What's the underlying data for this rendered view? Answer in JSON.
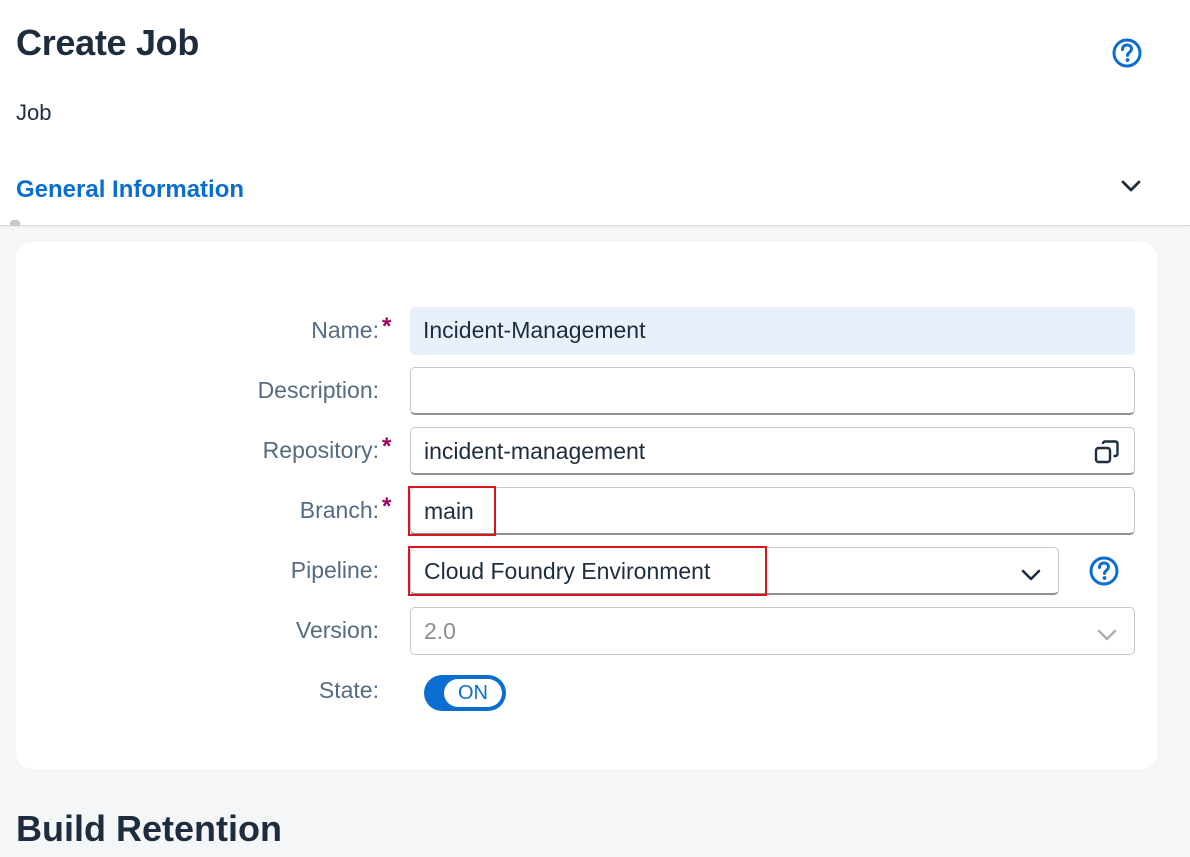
{
  "header": {
    "title": "Create Job",
    "subtitle": "Job",
    "section_tab": "General Information"
  },
  "form": {
    "name": {
      "label": "Name:",
      "value": "Incident-Management",
      "required": true
    },
    "description": {
      "label": "Description:",
      "value": "",
      "required": false
    },
    "repository": {
      "label": "Repository:",
      "value": "incident-management",
      "required": true
    },
    "branch": {
      "label": "Branch:",
      "value": "main",
      "required": true
    },
    "pipeline": {
      "label": "Pipeline:",
      "value": "Cloud Foundry Environment",
      "required": false
    },
    "version": {
      "label": "Version:",
      "value": "2.0",
      "required": false
    },
    "state": {
      "label": "State:",
      "value": "ON"
    },
    "required_marker": "*"
  },
  "build_retention": {
    "title": "Build Retention"
  },
  "colors": {
    "accent": "#0a6ed1",
    "title": "#1d2d3e",
    "label": "#556b82",
    "required": "#a50060",
    "highlight": "#d9141c",
    "filled_field": "#e8f0fc"
  },
  "icons": {
    "help": "help-circle-icon",
    "collapse": "chevron-down-icon",
    "copy": "copy-icon",
    "dropdown": "chevron-down-icon"
  }
}
